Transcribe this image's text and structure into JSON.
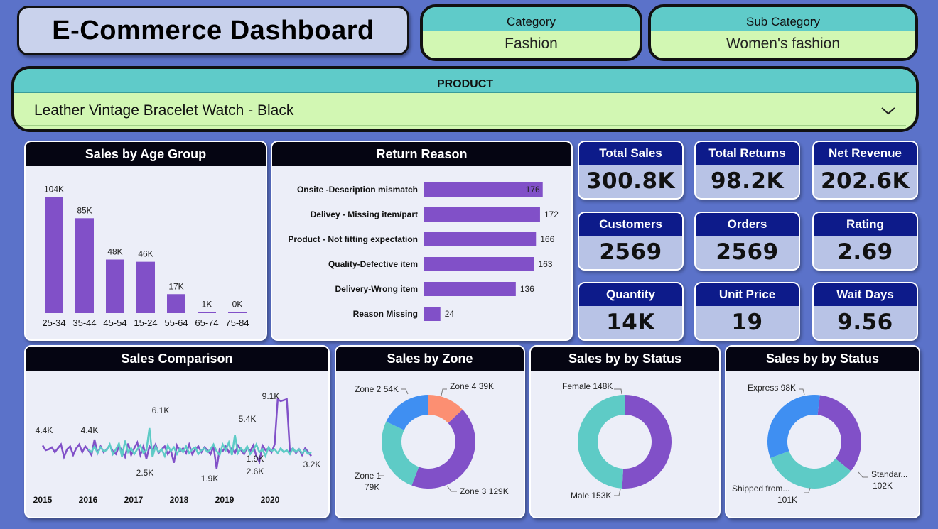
{
  "title": "E-Commerce Dashboard",
  "slicers": {
    "category": {
      "label": "Category",
      "value": "Fashion"
    },
    "sub_category": {
      "label": "Sub Category",
      "value": "Women's fashion"
    },
    "product": {
      "label": "PRODUCT",
      "value": "Leather Vintage Bracelet Watch - Black"
    }
  },
  "kpis": [
    {
      "label": "Total Sales",
      "value": "300.8K"
    },
    {
      "label": "Total Returns",
      "value": "98.2K"
    },
    {
      "label": "Net Revenue",
      "value": "202.6K"
    },
    {
      "label": "Customers",
      "value": "2569"
    },
    {
      "label": "Orders",
      "value": "2569"
    },
    {
      "label": "Rating",
      "value": "2.69"
    },
    {
      "label": "Quantity",
      "value": "14K"
    },
    {
      "label": "Unit Price",
      "value": "19"
    },
    {
      "label": "Wait Days",
      "value": "9.56"
    }
  ],
  "colors": {
    "bar": "#8150c8",
    "teal": "#5ecbc6",
    "blue": "#3f8ff2",
    "salmon": "#fc8f72",
    "purple": "#8150c8"
  },
  "chart_data": [
    {
      "type": "bar",
      "title": "Sales by Age Group",
      "categories": [
        "25-34",
        "35-44",
        "45-54",
        "15-24",
        "55-64",
        "65-74",
        "75-84"
      ],
      "values": [
        104,
        85,
        48,
        46,
        17,
        1,
        0.3
      ],
      "labels": [
        "104K",
        "85K",
        "48K",
        "46K",
        "17K",
        "1K",
        "0K"
      ],
      "ylim": [
        0,
        110
      ]
    },
    {
      "type": "bar",
      "orientation": "horizontal",
      "title": "Return Reason",
      "categories": [
        "Onsite -Description mismatch",
        "Delivey - Missing item/part",
        "Product - Not fitting expectation",
        "Quality-Defective item",
        "Delivery-Wrong item",
        "Reason Missing"
      ],
      "values": [
        176,
        172,
        166,
        163,
        136,
        24
      ],
      "xlim": [
        0,
        190
      ]
    },
    {
      "type": "line",
      "title": "Sales Comparison",
      "x_ticks": [
        "2015",
        "2016",
        "2017",
        "2018",
        "2019",
        "2020"
      ],
      "annotations": [
        "4.4K",
        "4.4K",
        "6.1K",
        "5.4K",
        "9.1K",
        "2.5K",
        "1.9K",
        "1.9K",
        "2.6K",
        "3.2K"
      ],
      "series": [
        {
          "values": [
            4.3,
            3.8,
            3.9,
            4.1,
            3.6,
            4.0,
            4.4,
            3.1,
            3.9,
            4.2,
            3.3,
            4.0,
            4.4,
            3.6,
            4.2,
            3.8,
            3.3,
            4.9,
            3.5,
            4.2,
            3.6,
            3.9,
            4.3,
            3.7,
            3.4,
            4.2,
            3.8,
            3.1,
            4.5,
            3.3,
            4.0,
            4.6,
            3.3,
            4.2,
            2.9,
            4.2,
            3.8,
            4.4,
            3.5,
            3.9,
            4.2,
            3.4,
            3.8,
            2.5,
            4.3,
            3.7,
            4.0,
            3.5,
            4.4,
            3.4,
            3.9,
            4.2,
            3.6,
            4.1,
            3.8,
            3.4,
            4.2,
            1.9,
            3.9,
            3.7,
            4.2,
            3.6,
            4.0,
            3.5,
            4.3,
            3.8,
            3.4,
            4.1,
            3.7,
            4.3,
            3.2,
            2.6,
            4.3,
            3.8,
            4.0,
            3.6,
            4.4,
            9.1,
            8.9,
            9.0,
            9.1,
            3.7,
            4.0,
            3.5,
            3.9,
            3.3,
            4.0,
            3.6,
            3.2
          ]
        },
        {
          "values": [
            null,
            null,
            null,
            null,
            null,
            null,
            null,
            null,
            null,
            null,
            null,
            null,
            null,
            null,
            null,
            3.9,
            3.6,
            4.2,
            3.5,
            4.1,
            3.7,
            3.8,
            4.4,
            3.4,
            3.9,
            4.5,
            3.1,
            4.8,
            3.6,
            4.0,
            3.4,
            3.9,
            4.3,
            3.5,
            3.8,
            6.1,
            3.1,
            4.2,
            3.6,
            3.9,
            3.2,
            4.3,
            3.7,
            4.1,
            3.4,
            4.0,
            3.6,
            4.2,
            3.5,
            3.9,
            4.1,
            3.4,
            3.8,
            4.0,
            3.6,
            3.9,
            4.4,
            3.7,
            3.3,
            4.4,
            3.8,
            4.6,
            3.3,
            5.4,
            3.5,
            4.0,
            3.6,
            4.2,
            3.4,
            3.8,
            4.4,
            3.6,
            3.9,
            3.2,
            4.1,
            3.7,
            3.9,
            3.5,
            4.0,
            3.6,
            3.8,
            3.4,
            4.0,
            3.6,
            3.9,
            3.5,
            3.8,
            3.4,
            3.6
          ]
        }
      ]
    },
    {
      "type": "pie",
      "title": "Sales by Zone",
      "categories": [
        "Zone 1",
        "Zone 2",
        "Zone 3",
        "Zone 4"
      ],
      "values": [
        79,
        54,
        129,
        39
      ],
      "labels": [
        "Zone 1",
        "79K",
        "Zone 2 54K",
        "Zone 3 129K",
        "Zone 4 39K"
      ]
    },
    {
      "type": "pie",
      "title": "Sales by by Status",
      "categories": [
        "Female",
        "Male"
      ],
      "values": [
        148,
        153
      ],
      "labels": [
        "Female 148K",
        "Male 153K"
      ]
    },
    {
      "type": "pie",
      "title": "Sales by by Status",
      "categories": [
        "Express",
        "Standar...",
        "Shipped from..."
      ],
      "values": [
        98,
        102,
        101
      ],
      "labels": [
        "Express 98K",
        "Standar...",
        "102K",
        "Shipped from...",
        "101K"
      ]
    }
  ]
}
